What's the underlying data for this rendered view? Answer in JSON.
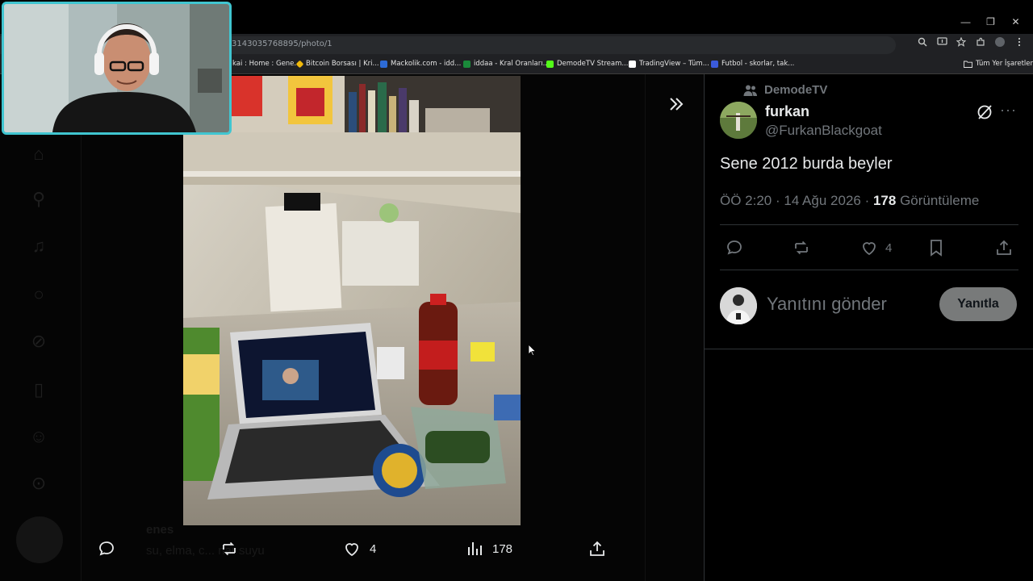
{
  "browser": {
    "url": "3143035768895/photo/1",
    "window_controls": {
      "minimize": "—",
      "restore": "❐",
      "close": "✕"
    },
    "bookmarks": [
      {
        "label": "kai : Home : Gene...",
        "color": "#1f1f1f"
      },
      {
        "label": "Bitcoin Borsası | Kri...",
        "color": "#f0b90b"
      },
      {
        "label": "Mackolik.com - idd...",
        "color": "#2d6bd6"
      },
      {
        "label": "iddaa - Kral Oranları...",
        "color": "#1a8a3a"
      },
      {
        "label": "DemodeTV Stream...",
        "color": "#53fc18"
      },
      {
        "label": "TradingView – Tüm...",
        "color": "#ffffff"
      },
      {
        "label": "Futbol - skorlar, tak...",
        "color": "#3b5bdb"
      }
    ],
    "all_bookmarks": "Tüm Yer İşaretleri"
  },
  "photo_view": {
    "actions": {
      "likes": "4",
      "views": "178"
    }
  },
  "tweet": {
    "community": "DemodeTV",
    "display_name": "furkan",
    "handle": "@FurkanBlackgoat",
    "text": "Sene 2012 burda beyler",
    "time": "ÖÖ 2:20 · 14 Ağu 2026 · ",
    "views_count": "178",
    "views_label": " Görüntüleme",
    "likes": "4",
    "reply_placeholder": "Yanıtını gönder",
    "reply_button": "Yanıtla"
  },
  "background_page": {
    "reply_user": "enes",
    "reply_text": "su, elma, c... nar suyu"
  },
  "colors": {
    "webcam_border": "#40c5d0",
    "muted": "#71767b",
    "reply_button_bg": "#787a7a"
  }
}
